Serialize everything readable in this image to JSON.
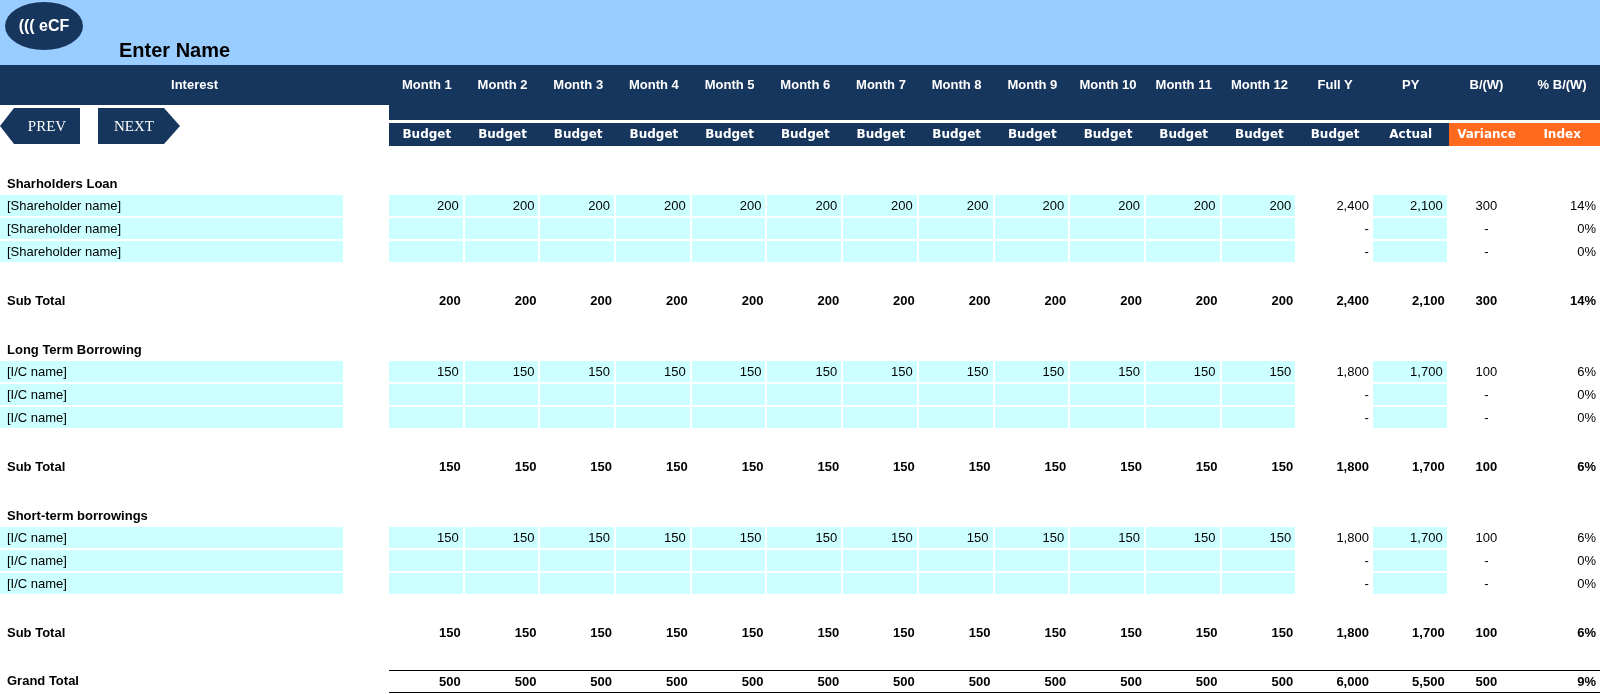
{
  "logo": {
    "text": "((( eCF"
  },
  "title": "Enter Name",
  "header": {
    "label": "Interest"
  },
  "nav": [
    {
      "label": "PREV",
      "kind": "prev"
    },
    {
      "label": "NEXT",
      "kind": "next"
    }
  ],
  "columns": [
    {
      "title": "Month 1",
      "subtitle": "Budget",
      "highlight": false
    },
    {
      "title": "Month 2",
      "subtitle": "Budget",
      "highlight": false
    },
    {
      "title": "Month 3",
      "subtitle": "Budget",
      "highlight": false
    },
    {
      "title": "Month 4",
      "subtitle": "Budget",
      "highlight": false
    },
    {
      "title": "Month 5",
      "subtitle": "Budget",
      "highlight": false
    },
    {
      "title": "Month 6",
      "subtitle": "Budget",
      "highlight": false
    },
    {
      "title": "Month 7",
      "subtitle": "Budget",
      "highlight": false
    },
    {
      "title": "Month 8",
      "subtitle": "Budget",
      "highlight": false
    },
    {
      "title": "Month 9",
      "subtitle": "Budget",
      "highlight": false
    },
    {
      "title": "Month 10",
      "subtitle": "Budget",
      "highlight": false
    },
    {
      "title": "Month 11",
      "subtitle": "Budget",
      "highlight": false
    },
    {
      "title": "Month 12",
      "subtitle": "Budget",
      "highlight": false
    },
    {
      "title": "Full Y",
      "subtitle": "Budget",
      "highlight": false
    },
    {
      "title": "PY",
      "subtitle": "Actual",
      "highlight": false
    },
    {
      "title": "B/(W)",
      "subtitle": "Variance",
      "highlight": true
    },
    {
      "title": "% B/(W)",
      "subtitle": "Index",
      "highlight": true
    }
  ],
  "sections": [
    {
      "title": "Sharholders Loan",
      "rows": [
        {
          "label": "[Shareholder name]",
          "months": [
            "200",
            "200",
            "200",
            "200",
            "200",
            "200",
            "200",
            "200",
            "200",
            "200",
            "200",
            "200"
          ],
          "full_year": "2,400",
          "py": "2,100",
          "variance": "300",
          "index": "14%"
        },
        {
          "label": "[Shareholder name]",
          "full_year": "-",
          "variance": "-",
          "index": "0%"
        },
        {
          "label": "[Shareholder name]",
          "full_year": "-",
          "variance": "-",
          "index": "0%"
        }
      ],
      "subtotal": {
        "label": "Sub Total",
        "months": [
          "200",
          "200",
          "200",
          "200",
          "200",
          "200",
          "200",
          "200",
          "200",
          "200",
          "200",
          "200"
        ],
        "full_year": "2,400",
        "py": "2,100",
        "variance": "300",
        "index": "14%"
      }
    },
    {
      "title": "Long Term Borrowing",
      "rows": [
        {
          "label": "[I/C name]",
          "months": [
            "150",
            "150",
            "150",
            "150",
            "150",
            "150",
            "150",
            "150",
            "150",
            "150",
            "150",
            "150"
          ],
          "full_year": "1,800",
          "py": "1,700",
          "variance": "100",
          "index": "6%"
        },
        {
          "label": "[I/C name]",
          "full_year": "-",
          "variance": "-",
          "index": "0%"
        },
        {
          "label": "[I/C name]",
          "full_year": "-",
          "variance": "-",
          "index": "0%"
        }
      ],
      "subtotal": {
        "label": "Sub Total",
        "months": [
          "150",
          "150",
          "150",
          "150",
          "150",
          "150",
          "150",
          "150",
          "150",
          "150",
          "150",
          "150"
        ],
        "full_year": "1,800",
        "py": "1,700",
        "variance": "100",
        "index": "6%"
      }
    },
    {
      "title": "Short-term borrowings",
      "rows": [
        {
          "label": "[I/C name]",
          "months": [
            "150",
            "150",
            "150",
            "150",
            "150",
            "150",
            "150",
            "150",
            "150",
            "150",
            "150",
            "150"
          ],
          "full_year": "1,800",
          "py": "1,700",
          "variance": "100",
          "index": "6%"
        },
        {
          "label": "[I/C name]",
          "full_year": "-",
          "variance": "-",
          "index": "0%"
        },
        {
          "label": "[I/C name]",
          "full_year": "-",
          "variance": "-",
          "index": "0%"
        }
      ],
      "subtotal": {
        "label": "Sub Total",
        "months": [
          "150",
          "150",
          "150",
          "150",
          "150",
          "150",
          "150",
          "150",
          "150",
          "150",
          "150",
          "150"
        ],
        "full_year": "1,800",
        "py": "1,700",
        "variance": "100",
        "index": "6%"
      }
    }
  ],
  "grand_total": {
    "label": "Grand Total",
    "months": [
      "500",
      "500",
      "500",
      "500",
      "500",
      "500",
      "500",
      "500",
      "500",
      "500",
      "500",
      "500"
    ],
    "full_year": "6,000",
    "py": "5,500",
    "variance": "500",
    "index": "9%"
  }
}
